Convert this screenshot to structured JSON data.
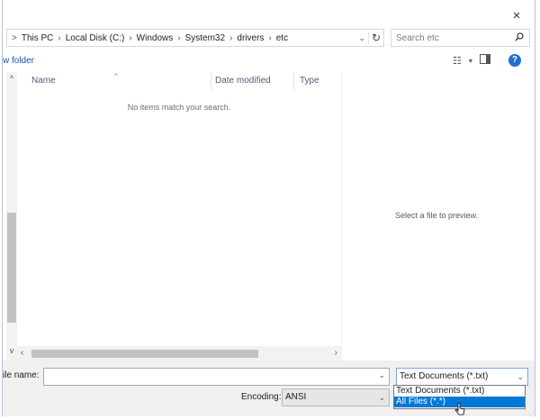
{
  "window": {
    "close_label": "×"
  },
  "address": {
    "crumbs": [
      "This PC",
      "Local Disk (C:)",
      "Windows",
      "System32",
      "drivers",
      "etc"
    ],
    "lead_chevron": ">"
  },
  "search": {
    "placeholder": "Search etc"
  },
  "toolbar": {
    "new_folder_label": "w folder"
  },
  "columns": {
    "name": "Name",
    "date": "Date modified",
    "type": "Type"
  },
  "list": {
    "empty_message": "No items match your search."
  },
  "preview": {
    "message": "Select a file to preview."
  },
  "footer": {
    "file_name_label": "ile name:",
    "file_name_value": "",
    "file_type_selected": "Text Documents (*.txt)",
    "encoding_label": "Encoding:",
    "encoding_value": "ANSI"
  },
  "file_type_options": [
    {
      "label": "Text Documents (*.txt)",
      "selected": false
    },
    {
      "label": "All Files  (*.*)",
      "selected": true
    }
  ],
  "colors": {
    "accent": "#0078d7",
    "link": "#1a56a8",
    "help": "#1f6fd1"
  }
}
